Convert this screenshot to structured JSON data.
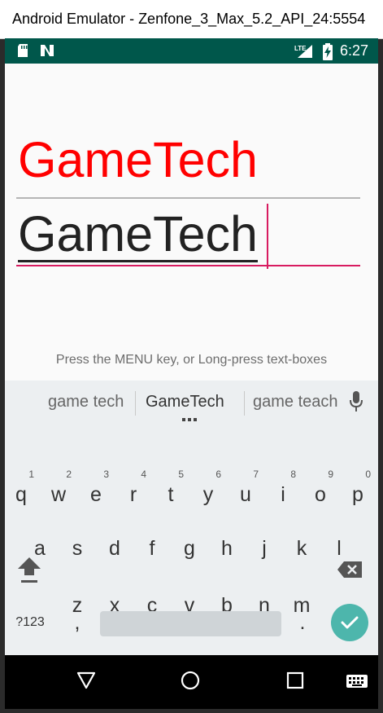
{
  "window": {
    "title": "Android Emulator - Zenfone_3_Max_5.2_API_24:5554"
  },
  "statusbar": {
    "time": "6:27",
    "network_label": "LTE",
    "icons": [
      "sd-card-icon",
      "n-notification-icon",
      "lte-signal-icon",
      "battery-charging-icon"
    ]
  },
  "app": {
    "heading": "GameTech",
    "input_value": "GameTech",
    "hint": "Press the MENU key, or Long-press text-boxes",
    "accent_color": "#d81b60",
    "heading_color": "#ff0000"
  },
  "keyboard": {
    "suggestions": [
      "game tech",
      "GameTech",
      "game teach"
    ],
    "row1": [
      "q",
      "w",
      "e",
      "r",
      "t",
      "y",
      "u",
      "i",
      "o",
      "p"
    ],
    "row1_hints": [
      "1",
      "2",
      "3",
      "4",
      "5",
      "6",
      "7",
      "8",
      "9",
      "0"
    ],
    "row2": [
      "a",
      "s",
      "d",
      "f",
      "g",
      "h",
      "j",
      "k",
      "l"
    ],
    "row3": [
      "z",
      "x",
      "c",
      "v",
      "b",
      "n",
      "m"
    ],
    "symbols_label": "?123",
    "comma": ",",
    "period": "."
  },
  "navbar": {
    "icons": [
      "back-icon",
      "home-icon",
      "recents-icon",
      "keyboard-icon"
    ]
  }
}
